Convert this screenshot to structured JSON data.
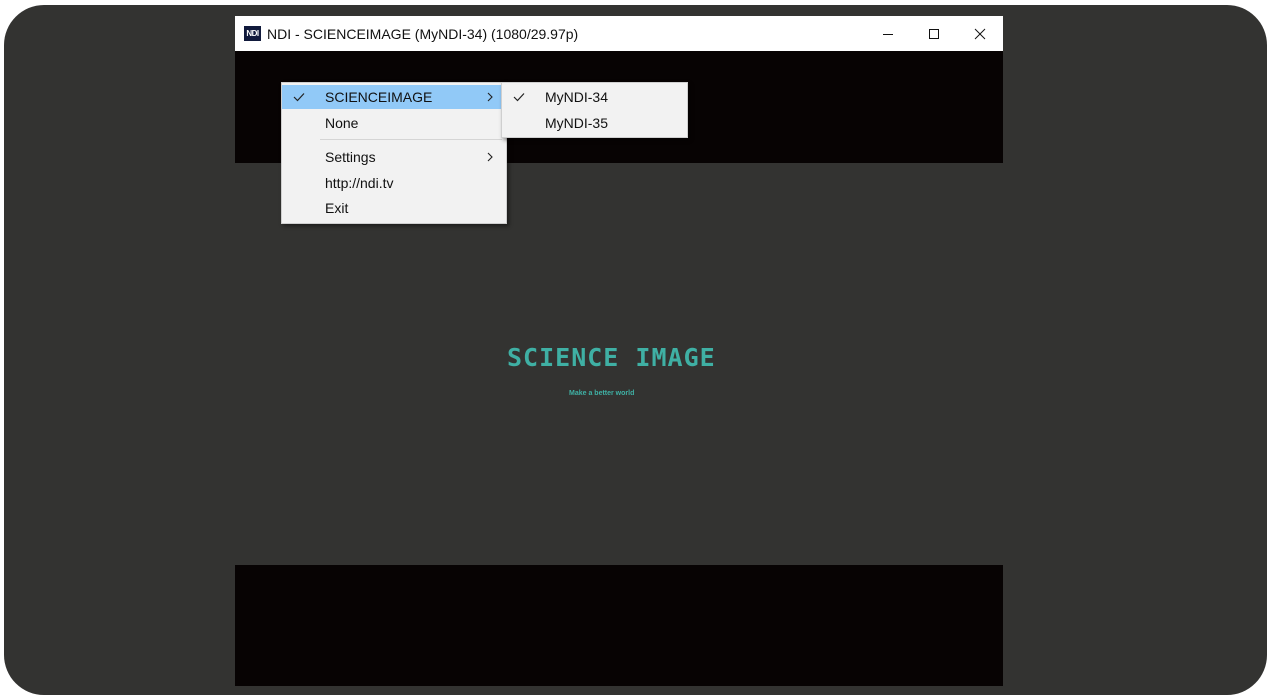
{
  "window": {
    "icon_label": "NDI",
    "title": "NDI - SCIENCEIMAGE (MyNDI-34) (1080/29.97p)",
    "controls": [
      "minimize-icon",
      "maximize-icon",
      "close-icon"
    ]
  },
  "video": {
    "logo_title": "SCIENCE IMAGE",
    "logo_subtitle": "Make a better world"
  },
  "menu": {
    "items": [
      {
        "label": "SCIENCEIMAGE",
        "checked": true,
        "submenu": true,
        "highlighted": true
      },
      {
        "label": "None",
        "checked": false,
        "submenu": false
      },
      {
        "label": "Settings",
        "checked": false,
        "submenu": true
      },
      {
        "label": "http://ndi.tv",
        "checked": false,
        "submenu": false
      },
      {
        "label": "Exit",
        "checked": false,
        "submenu": false
      }
    ]
  },
  "submenu": {
    "items": [
      {
        "label": "MyNDI-34",
        "checked": true
      },
      {
        "label": "MyNDI-35",
        "checked": false
      }
    ]
  },
  "colors": {
    "accent_teal": "#3fb0a4",
    "menu_highlight": "#91c9f7",
    "frame_background": "#333331"
  }
}
